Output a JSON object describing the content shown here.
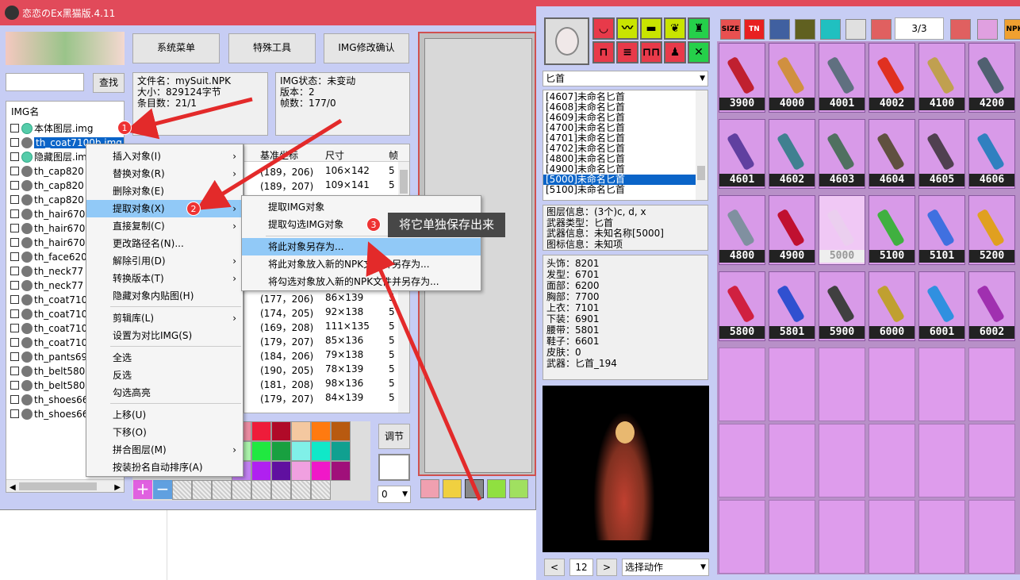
{
  "left_window": {
    "title": "恋恋のEx黑猫版.4.11",
    "buttons": {
      "system_menu": "系统菜单",
      "special_tools": "特殊工具",
      "img_confirm": "IMG修改确认",
      "search": "查找",
      "adjust": "调节"
    },
    "file_info": {
      "name": "文件名：mySuit.NPK",
      "size": "大小：829124字节",
      "count": "条目数：21/1"
    },
    "img_info": {
      "state": "IMG状态：未变动",
      "version": "版本：2",
      "frames": "帧数：177/0"
    },
    "list_header": "IMG名",
    "img_list": [
      "本体图层.img",
      "th_coat7100b.img",
      "隐藏图层.im",
      "th_cap820",
      "th_cap820",
      "th_cap820",
      "th_hair670",
      "th_hair670",
      "th_hair670",
      "th_face620",
      "th_neck77",
      "th_neck77",
      "th_coat710",
      "th_coat710",
      "th_coat710",
      "th_coat710",
      "th_pants69",
      "th_belt580",
      "th_belt580",
      "th_shoes66",
      "th_shoes66"
    ],
    "table_headers": [
      "基准坐标",
      "尺寸",
      "帧"
    ],
    "table_rows": [
      [
        "(189，206)",
        "106×142",
        "5"
      ],
      [
        "(189，207)",
        "109×141",
        "5"
      ],
      [
        "(177，206)",
        "86×139",
        "5"
      ],
      [
        "(174，205)",
        "92×138",
        "5"
      ],
      [
        "(169，208)",
        "111×135",
        "5"
      ],
      [
        "(179，207)",
        "85×136",
        "5"
      ],
      [
        "(184，206)",
        "79×138",
        "5"
      ],
      [
        "(190，205)",
        "78×139",
        "5"
      ],
      [
        "(181，208)",
        "98×136",
        "5"
      ],
      [
        "(179，207)",
        "84×139",
        "5"
      ]
    ],
    "combo_value": "0",
    "palette_colors": [
      "#e88aa0",
      "#ee1c3a",
      "#b00a28",
      "#f4c8a0",
      "#ff7a10",
      "#b85a10",
      "#a8f0a8",
      "#20e840",
      "#18a040",
      "#80f0e8",
      "#10e8c8",
      "#10a090",
      "#c080f0",
      "#b020f0",
      "#6010a0",
      "#f0a0e0",
      "#f018c8",
      "#a0107a"
    ]
  },
  "context_menu": {
    "items": [
      "插入对象(I)",
      "替换对象(R)",
      "删除对象(E)",
      "提取对象(X)",
      "直接复制(C)",
      "更改路径名(N)...",
      "解除引用(D)",
      "转换版本(T)",
      "隐藏对象内贴图(H)",
      "剪辑库(L)",
      "设置为对比IMG(S)",
      "全选",
      "反选",
      "勾选高亮",
      "上移(U)",
      "下移(O)",
      "拼合图层(M)",
      "按装扮名自动排序(A)"
    ]
  },
  "submenu": {
    "items": [
      "提取IMG对象",
      "提取勾选IMG对象",
      "将此对象另存为...",
      "将此对象放入新的NPK文件并另存为...",
      "将勾选对象放入新的NPK文件并另存为..."
    ]
  },
  "tooltip": "将它单独保存出来",
  "badges": [
    "1",
    "2",
    "3"
  ],
  "right_window": {
    "category_select": "匕首",
    "weapon_list": [
      "[4607]未命名匕首",
      "[4608]未命名匕首",
      "[4609]未命名匕首",
      "[4700]未命名匕首",
      "[4701]未命名匕首",
      "[4702]未命名匕首",
      "[4800]未命名匕首",
      "[4900]未命名匕首",
      "[5000]未命名匕首",
      "[5100]未命名匕首"
    ],
    "layer_info": [
      "图层信息：(3个)c, d, x",
      "武器类型：匕首",
      "武器信息：未知名称[5000]",
      "图标信息：未知项"
    ],
    "equip_info": [
      "头饰：8201",
      "发型：6701",
      "面部：6200",
      "胸部：7700",
      "上衣：7101",
      "下装：6901",
      "腰带：5801",
      "鞋子：6601",
      "皮肤：0",
      "武器：匕首_194"
    ],
    "page": "3/3",
    "frame_num": "12",
    "prev": "<",
    "next": ">",
    "action_select": "选择动作",
    "grid_labels": [
      "3900",
      "4000",
      "4001",
      "4002",
      "4100",
      "4200",
      "4601",
      "4602",
      "4603",
      "4604",
      "4605",
      "4606",
      "4800",
      "4900",
      "5000",
      "5100",
      "5101",
      "5200",
      "5800",
      "5801",
      "5900",
      "6000",
      "6001",
      "6002"
    ],
    "dagger_colors": [
      "#c02030",
      "#d09040",
      "#607080",
      "#e03020",
      "#c0a050",
      "#506070",
      "#6040a0",
      "#408090",
      "#507060",
      "#605040",
      "#504050",
      "#3080c0",
      "#8090a0",
      "#c01030",
      "#e0e0e0",
      "#40b040",
      "#4070e0",
      "#e0a020",
      "#d02040",
      "#3050d0",
      "#404040",
      "#c0a030",
      "#3090e0",
      "#a030b0"
    ]
  }
}
